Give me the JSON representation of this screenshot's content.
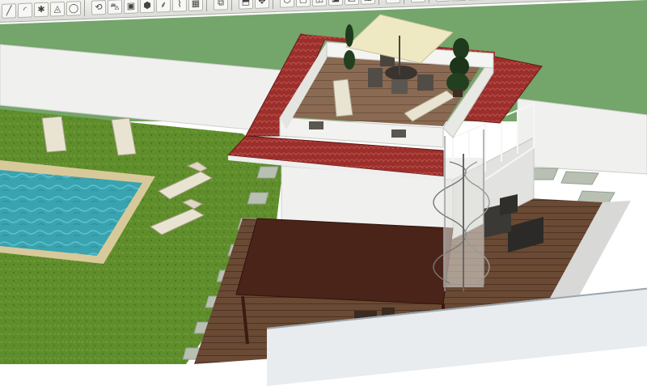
{
  "app": {
    "window_type": "3d-modeling-viewport"
  },
  "toolbar": {
    "buttons": [
      {
        "name": "line-tool",
        "icon": "line-icon",
        "glyph": "╱"
      },
      {
        "name": "arc-tool",
        "icon": "arc-icon",
        "glyph": "◜"
      },
      {
        "name": "freehand-tool",
        "icon": "freehand-icon",
        "glyph": "✱"
      },
      {
        "name": "shape-tool",
        "icon": "triangle-icon",
        "glyph": "◬"
      },
      {
        "name": "circle-tool",
        "icon": "circle-icon",
        "glyph": "◯"
      },
      {
        "name": "sep",
        "icon": "separator"
      },
      {
        "name": "orbit-tool",
        "icon": "orbit-icon",
        "glyph": "⟲"
      },
      {
        "name": "car-tool",
        "icon": "car-icon",
        "glyph": "⛍"
      },
      {
        "name": "box-tool",
        "icon": "box-icon",
        "glyph": "▣"
      },
      {
        "name": "cube-tool",
        "icon": "cube-icon",
        "glyph": "⬢"
      },
      {
        "name": "grass-tool",
        "icon": "grass-icon",
        "glyph": "⸙"
      },
      {
        "name": "brush-tool",
        "icon": "brush-icon",
        "glyph": "⌇"
      },
      {
        "name": "grid-tool",
        "icon": "grid-icon",
        "glyph": "▦"
      },
      {
        "name": "sep",
        "icon": "separator"
      },
      {
        "name": "layers-tool",
        "icon": "layers-icon",
        "glyph": "⧉"
      },
      {
        "name": "sep",
        "icon": "separator"
      },
      {
        "name": "push-pull-tool",
        "icon": "push-pull-icon",
        "glyph": "⬒"
      },
      {
        "name": "move-tool",
        "icon": "move-icon",
        "glyph": "✥"
      },
      {
        "name": "sep",
        "icon": "separator"
      },
      {
        "name": "iso-view",
        "icon": "iso-view-icon",
        "glyph": "⬡"
      },
      {
        "name": "top-view",
        "icon": "top-view-icon",
        "glyph": "▢"
      },
      {
        "name": "front-view",
        "icon": "front-view-icon",
        "glyph": "◫"
      },
      {
        "name": "right-view",
        "icon": "right-view-icon",
        "glyph": "◪"
      },
      {
        "name": "back-view",
        "icon": "back-view-icon",
        "glyph": "◩"
      },
      {
        "name": "left-view",
        "icon": "left-view-icon",
        "glyph": "◨"
      },
      {
        "name": "sep",
        "icon": "separator"
      },
      {
        "name": "components-tool",
        "icon": "components-icon",
        "glyph": "⬙"
      },
      {
        "name": "sep",
        "icon": "separator"
      },
      {
        "name": "styles-tool",
        "icon": "styles-icon",
        "glyph": "◭"
      },
      {
        "name": "sep",
        "icon": "separator"
      },
      {
        "name": "paint-tool",
        "icon": "paint-bucket-icon",
        "glyph": "◆"
      },
      {
        "name": "materials-tool",
        "icon": "materials-icon",
        "glyph": "◈"
      },
      {
        "name": "texture-tool",
        "icon": "texture-icon",
        "glyph": "◇"
      },
      {
        "name": "section-tool",
        "icon": "section-icon",
        "glyph": "◪"
      },
      {
        "name": "shadow-tool",
        "icon": "shadow-icon",
        "glyph": "◕"
      },
      {
        "name": "fog-tool",
        "icon": "fog-icon",
        "glyph": "◎"
      },
      {
        "name": "more-tool",
        "icon": "more-icon",
        "glyph": "▤"
      }
    ]
  },
  "scene": {
    "colors": {
      "sky": "#f3f5f3",
      "green_ground": "#74a56a",
      "lawn": "#5f8d2b",
      "lawn_dark": "#4a7220",
      "pool_water": "#3aa3b0",
      "pool_edge": "#d8c99a",
      "wall": "#f0f0ef",
      "wall_shadow": "#d8d8d6",
      "roof_tile": "#8e2a2a",
      "roof_tile_light": "#b8443a",
      "deck_wood": "#6a4a34",
      "deck_wood_dark": "#4d3324",
      "pergola": "#4a2418",
      "umbrella": "#efe9c3",
      "stair_steel": "#c9c9c6",
      "pavers": "#b8c0b3"
    },
    "objects": [
      "boundary-wall",
      "lawn",
      "pool",
      "lounge-chair",
      "rooftop-terrace",
      "roof-tile-band",
      "umbrella",
      "dining-set",
      "topiary",
      "spiral-staircase",
      "pergola",
      "lower-deck",
      "side-deck",
      "outdoor-furniture",
      "paver-path"
    ]
  }
}
